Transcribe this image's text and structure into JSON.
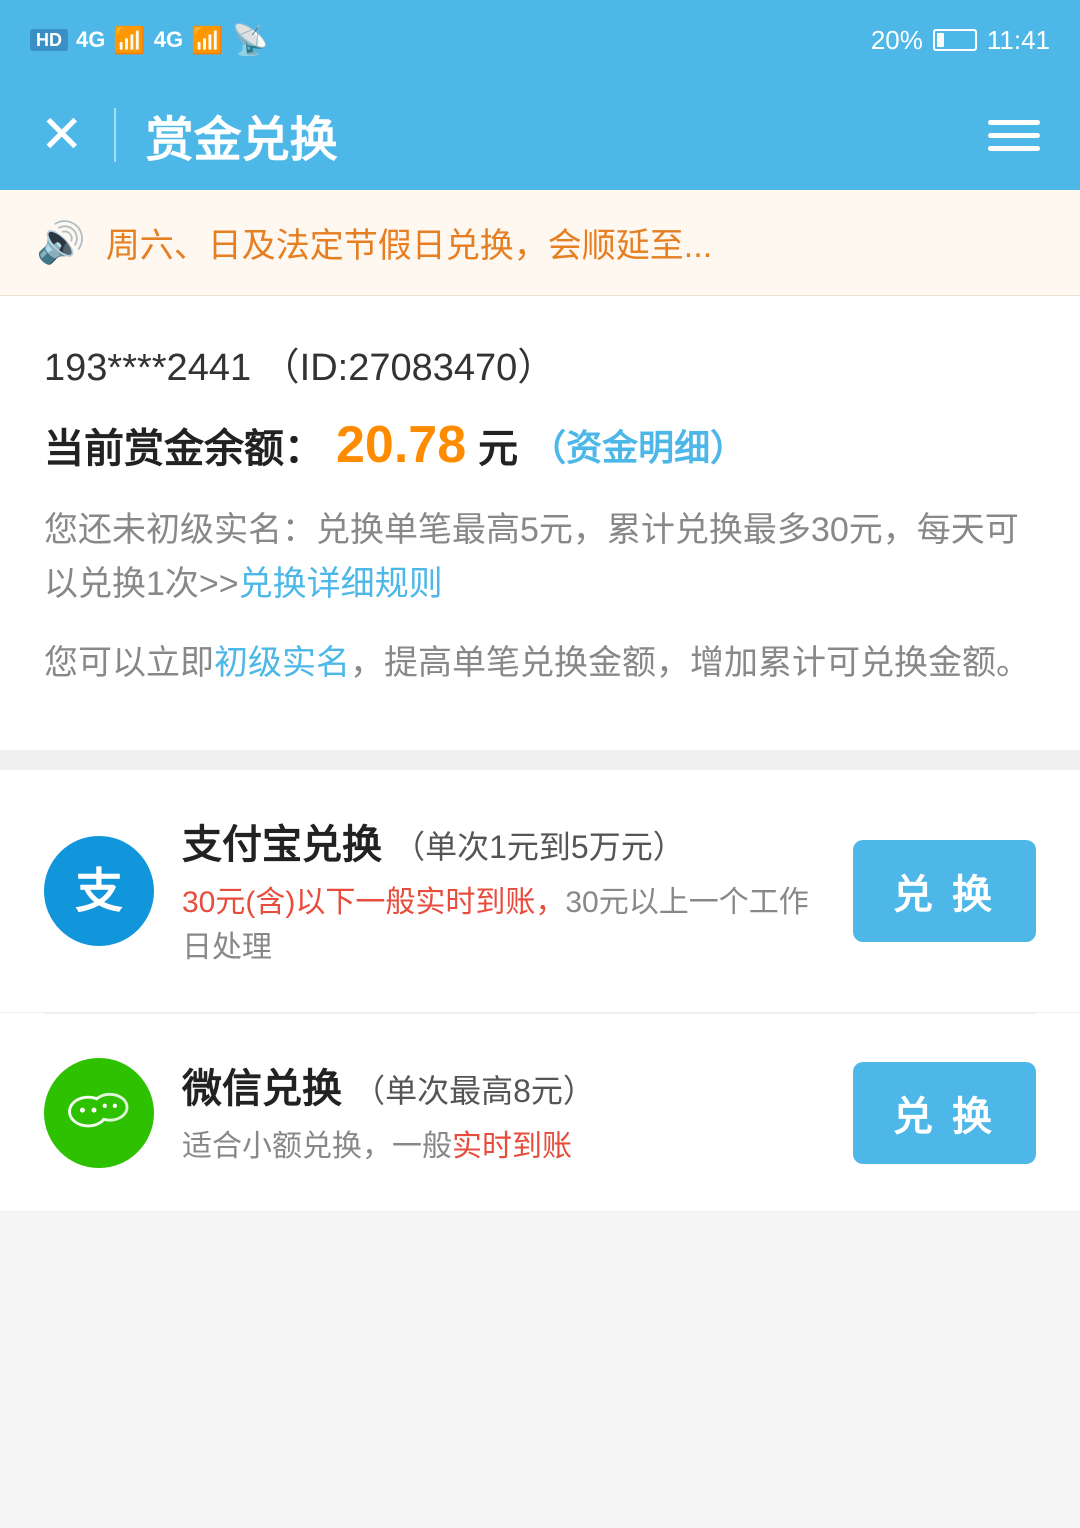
{
  "status_bar": {
    "hd_badge": "HD",
    "signal_text": "4G",
    "time": "11:41",
    "battery_percent": "20%"
  },
  "toolbar": {
    "close_label": "✕",
    "title": "赏金兑换",
    "menu_label": "menu"
  },
  "notice": {
    "text": "周六、日及法定节假日兑换，会顺延至..."
  },
  "user": {
    "id_display": "193****2441  （ID:27083470）"
  },
  "balance": {
    "label": "当前赏金余额：",
    "amount": "20.78",
    "unit": "元",
    "detail_link_text": "（资金明细）"
  },
  "limit_info": {
    "text1": "您还未初级实名：兑换单笔最高5元，累计兑换最多30元，每天可以兑换1次>>",
    "link": "兑换详细规则"
  },
  "verify_info": {
    "prefix": "您可以立即",
    "link": "初级实名",
    "suffix": "，提高单笔兑换金额，增加累计可兑换金额。"
  },
  "exchange_items": [
    {
      "id": "alipay",
      "name": "支付宝兑换",
      "sub_name": "（单次1元到5万元）",
      "desc_highlight": "30元(含)以下一般实时到账，",
      "desc_normal": "30元以上一个工作日处理",
      "btn_label": "兑 换",
      "logo_type": "alipay"
    },
    {
      "id": "wechat",
      "name": "微信兑换",
      "sub_name": "（单次最高8元）",
      "desc_normal": "适合小额兑换，一般",
      "desc_highlight": "实时到账",
      "btn_label": "兑 换",
      "logo_type": "wechat"
    }
  ]
}
